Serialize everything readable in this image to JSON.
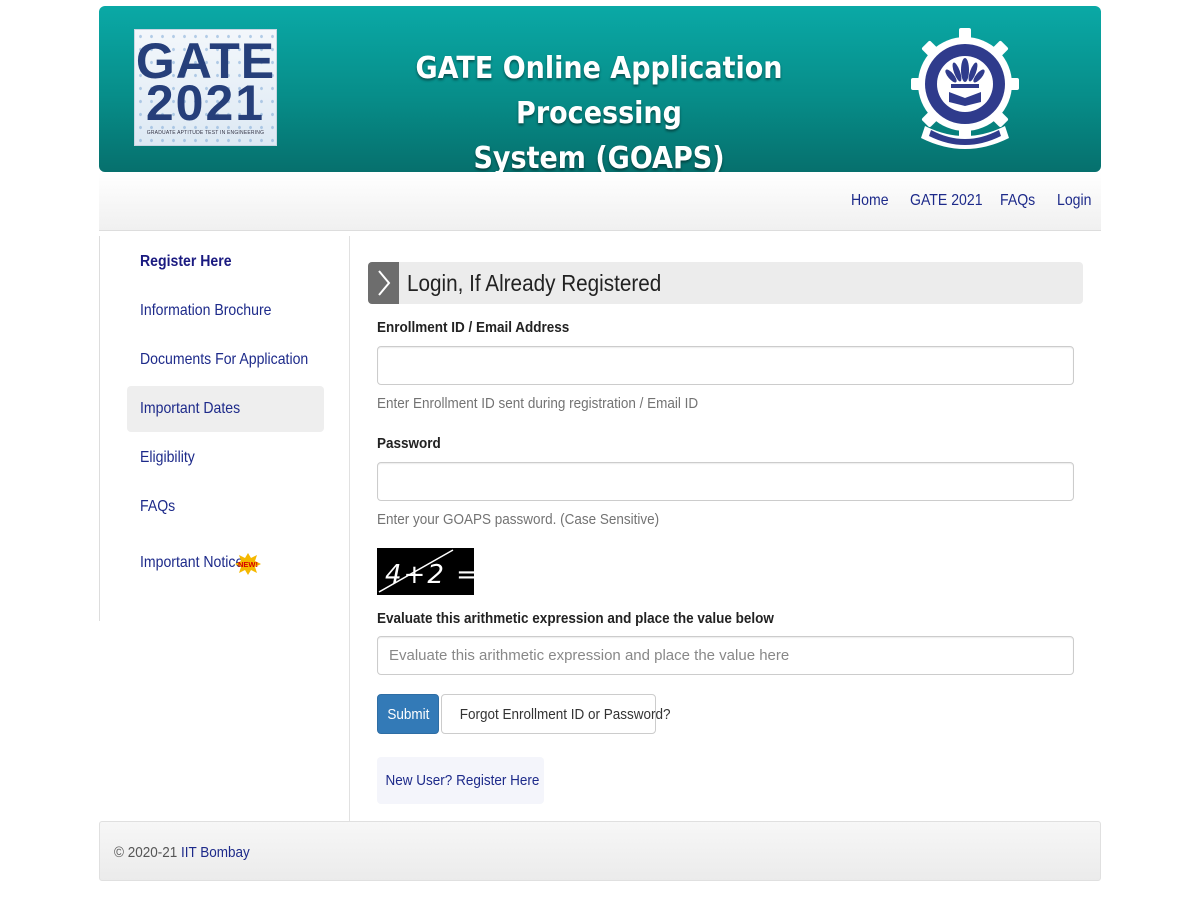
{
  "header": {
    "logo_line1": "GATE",
    "logo_line2": "2021",
    "logo_tagline": "GRADUATE APTITUDE TEST IN ENGINEERING",
    "title_line1": "GATE Online Application Processing",
    "title_line2": "System (GOAPS)",
    "colors": {
      "banner": "#0aa9a6",
      "banner_dark": "#06706d"
    }
  },
  "navbar": {
    "items": [
      "Home",
      "GATE 2021",
      "FAQs",
      "Login"
    ]
  },
  "sidebar": {
    "items": [
      {
        "label": "Register Here",
        "bold": true
      },
      {
        "label": "Information Brochure"
      },
      {
        "label": "Documents For Application"
      },
      {
        "label": "Important Dates",
        "active": true
      },
      {
        "label": "Eligibility"
      },
      {
        "label": "FAQs"
      },
      {
        "label": "Important Notice",
        "badge": "NEW!"
      }
    ]
  },
  "login": {
    "heading": "Login, If Already Registered",
    "enrollment_label": "Enrollment ID / Email Address",
    "enrollment_value": "",
    "enrollment_help": "Enter Enrollment ID sent during registration / Email ID",
    "password_label": "Password",
    "password_value": "",
    "password_help": "Enter your GOAPS password. (Case Sensitive)",
    "captcha_text": "4+2 =",
    "captcha_label": "Evaluate this arithmetic expression and place the value below",
    "captcha_placeholder": "Evaluate this arithmetic expression and place the value here",
    "submit_label": "Submit",
    "forgot_label": "Forgot Enrollment ID or Password?",
    "new_user_label": "New User? Register Here",
    "colors": {
      "primary": "#337ab7",
      "link": "#1d2a8a"
    }
  },
  "footer": {
    "copyright": "© 2020-21 ",
    "org": "IIT Bombay"
  }
}
